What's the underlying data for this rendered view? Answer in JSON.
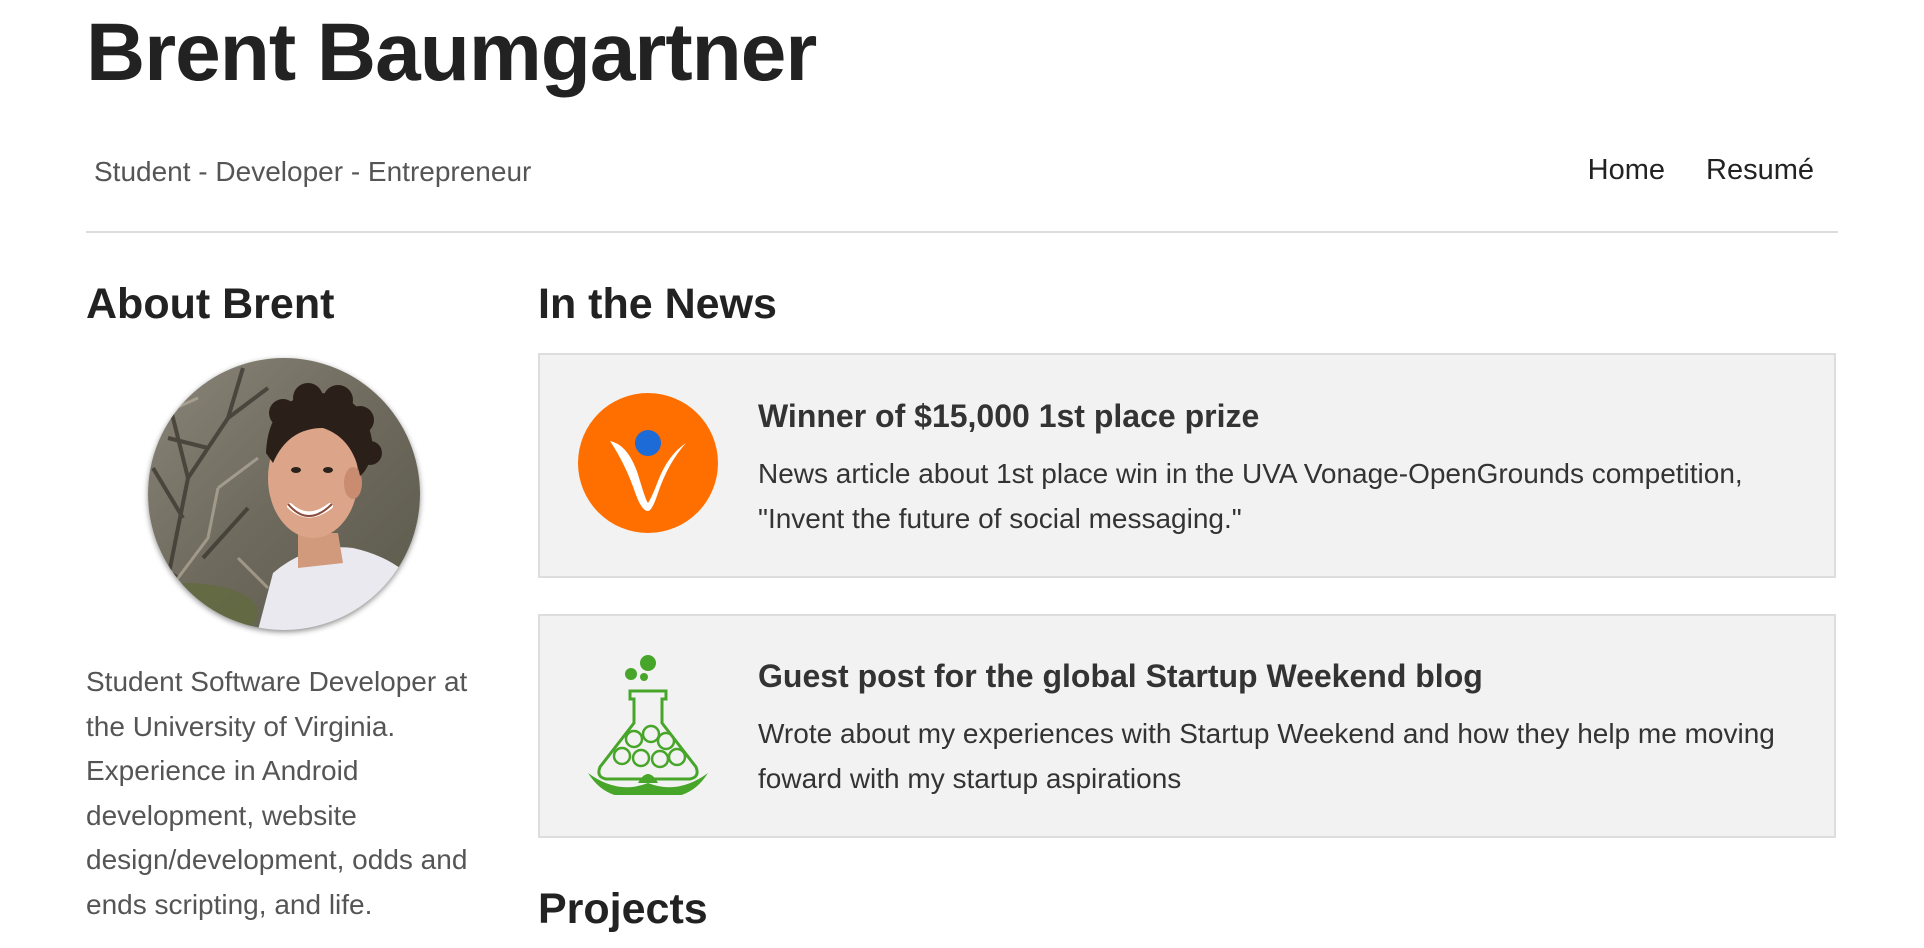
{
  "header": {
    "title": "Brent Baumgartner",
    "tagline": "Student - Developer - Entrepreneur"
  },
  "nav": {
    "items": [
      {
        "label": "Home"
      },
      {
        "label": "Resumé"
      }
    ]
  },
  "about": {
    "heading": "About Brent",
    "bio": "Student Software Developer at the University of Virginia. Experience in Android development, website design/development, odds and ends scripting, and life."
  },
  "news": {
    "heading": "In the News",
    "items": [
      {
        "icon": "vonage-logo-icon",
        "title": "Winner of $15,000 1st place prize",
        "description": "News article about 1st place win in the UVA Vonage-OpenGrounds competition, \"Invent the future of social messaging.\""
      },
      {
        "icon": "startup-weekend-flask-icon",
        "title": "Guest post for the global Startup Weekend blog",
        "description": "Wrote about my experiences with Startup Weekend and how they help me moving foward with my startup aspirations"
      }
    ]
  },
  "projects": {
    "heading": "Projects"
  },
  "colors": {
    "vonage_orange": "#ff6f00",
    "vonage_blue": "#1c6bd6",
    "startup_green": "#47a629",
    "card_background": "#f2f2f2",
    "card_border": "#dddddd"
  }
}
